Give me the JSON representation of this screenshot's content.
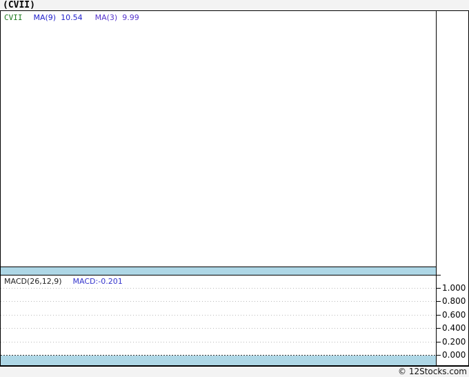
{
  "window_title": "(CVII)",
  "price_panel": {
    "legend": {
      "ticker": "CVII",
      "ma9_label": "MA(9)",
      "ma9_value": "10.54",
      "ma3_label": "MA(3)",
      "ma3_value": "9.99"
    }
  },
  "macd": {
    "legend_label": "MACD(26,12,9)",
    "legend_value": "MACD:-0.201",
    "ticks": [
      "1.000",
      "0.800",
      "0.600",
      "0.400",
      "0.200",
      "0.000"
    ]
  },
  "footer": {
    "credit": "© 12Stocks.com"
  },
  "colors": {
    "ticker_green": "#1e7a1e",
    "ma9_blue": "#2222cc",
    "ma3_purple": "#5533cc",
    "macd_value_blue": "#3333cc",
    "band_blue": "#aed7e6",
    "gridline_gray": "#b8b8b8",
    "page_background": "#f3f3f3",
    "chart_background": "#ffffff"
  },
  "chart_data": [
    {
      "type": "line",
      "title": "(CVII)",
      "series": [
        {
          "name": "CVII",
          "color": "#1e7a1e",
          "values": []
        },
        {
          "name": "MA(9)",
          "color": "#2222cc",
          "last_value": 10.54
        },
        {
          "name": "MA(3)",
          "color": "#5533cc",
          "last_value": 9.99
        }
      ],
      "grid": false,
      "note": "price panel renders empty - no plotted candles or lines visible"
    },
    {
      "type": "line",
      "title": "MACD(26,12,9)",
      "series": [
        {
          "name": "MACD",
          "last_value": -0.201
        }
      ],
      "ylim": [
        0.0,
        1.0
      ],
      "yticks": [
        1.0,
        0.8,
        0.6,
        0.4,
        0.2,
        0.0
      ],
      "grid": true,
      "legend_position": "top-left",
      "note": "no MACD curve visible in panel; value -0.201 lies below the displayed axis range"
    }
  ]
}
